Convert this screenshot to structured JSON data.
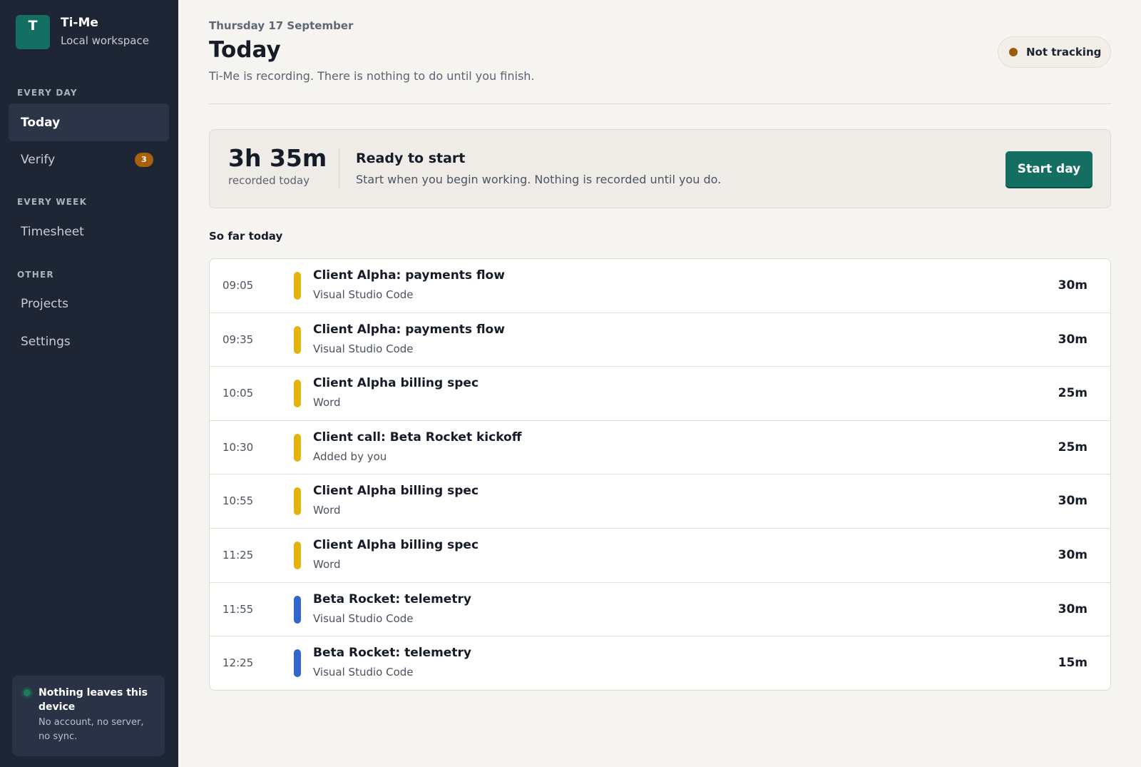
{
  "brand": {
    "initial": "T",
    "name": "Ti-Me",
    "subtitle": "Local workspace"
  },
  "sidebar": {
    "sections": [
      {
        "label": "EVERY DAY"
      },
      {
        "label": "EVERY WEEK"
      },
      {
        "label": "OTHER"
      }
    ],
    "items": [
      {
        "label": "Today",
        "active": true
      },
      {
        "label": "Verify",
        "badge": "3"
      },
      {
        "label": "Timesheet"
      },
      {
        "label": "Projects"
      },
      {
        "label": "Settings"
      }
    ],
    "privacy": {
      "title": "Nothing leaves this device",
      "subtitle": "No account, no server, no sync."
    }
  },
  "header": {
    "date": "Thursday 17 September",
    "title": "Today",
    "subtitle": "Ti-Me is recording. There is nothing to do until you finish.",
    "status": "Not tracking"
  },
  "summary": {
    "total": "3h 35m",
    "total_label": "recorded today",
    "title": "Ready to start",
    "subtitle": "Start when you begin working. Nothing is recorded until you do.",
    "button": "Start day"
  },
  "list_heading": "So far today",
  "entries": [
    {
      "time": "09:05",
      "title": "Client Alpha: payments flow",
      "source": "Visual Studio Code",
      "duration": "30m",
      "color": "#e3b30f"
    },
    {
      "time": "09:35",
      "title": "Client Alpha: payments flow",
      "source": "Visual Studio Code",
      "duration": "30m",
      "color": "#e3b30f"
    },
    {
      "time": "10:05",
      "title": "Client Alpha billing spec",
      "source": "Word",
      "duration": "25m",
      "color": "#e3b30f"
    },
    {
      "time": "10:30",
      "title": "Client call: Beta Rocket kickoff",
      "source": "Added by you",
      "duration": "25m",
      "color": "#e3b30f"
    },
    {
      "time": "10:55",
      "title": "Client Alpha billing spec",
      "source": "Word",
      "duration": "30m",
      "color": "#e3b30f"
    },
    {
      "time": "11:25",
      "title": "Client Alpha billing spec",
      "source": "Word",
      "duration": "30m",
      "color": "#e3b30f"
    },
    {
      "time": "11:55",
      "title": "Beta Rocket: telemetry",
      "source": "Visual Studio Code",
      "duration": "30m",
      "color": "#3366cc"
    },
    {
      "time": "12:25",
      "title": "Beta Rocket: telemetry",
      "source": "Visual Studio Code",
      "duration": "15m",
      "color": "#3366cc"
    }
  ]
}
